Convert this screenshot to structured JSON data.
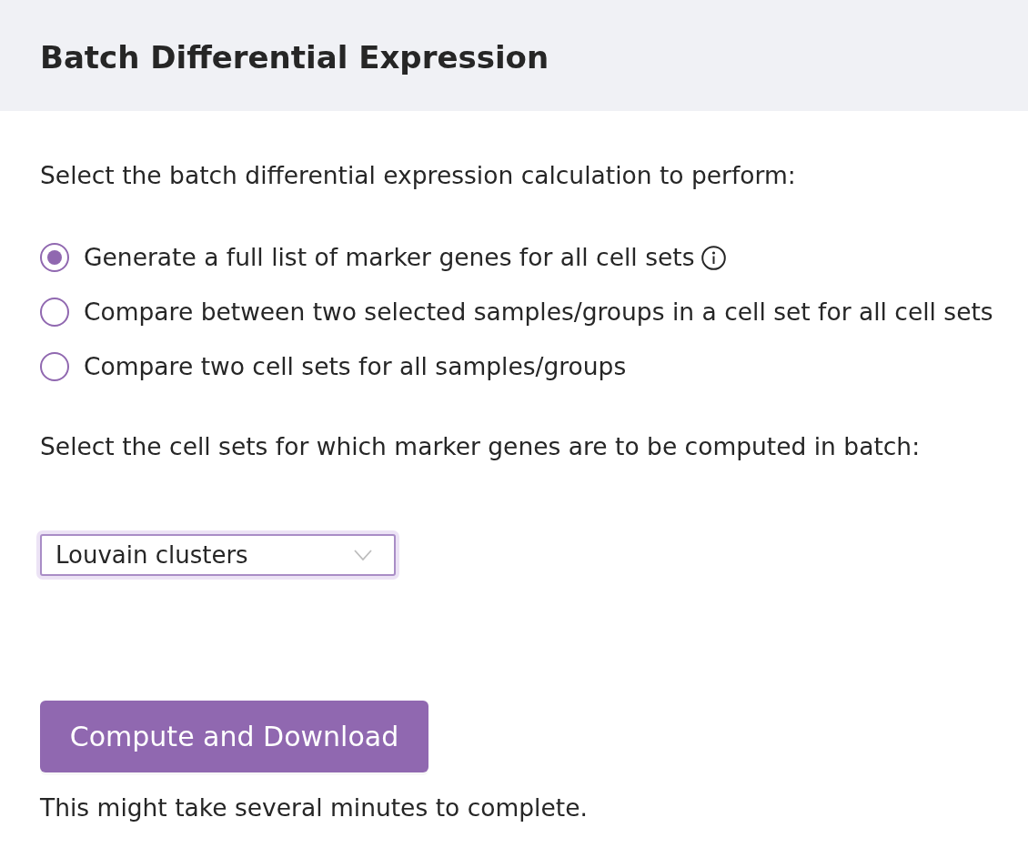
{
  "header": {
    "title": "Batch Differential Expression"
  },
  "calculation": {
    "prompt": "Select the batch differential expression calculation to perform:",
    "options": [
      {
        "label": "Generate a full list of marker genes for all cell sets",
        "selected": true,
        "info": true
      },
      {
        "label": "Compare between two selected samples/groups in a cell set for all cell sets",
        "selected": false,
        "info": false
      },
      {
        "label": "Compare two cell sets for all samples/groups",
        "selected": false,
        "info": false
      }
    ]
  },
  "cell_sets": {
    "prompt": "Select the cell sets for which marker genes are to be computed in batch:",
    "dropdown": {
      "value": "Louvain clusters",
      "focused": true
    }
  },
  "compute_button": {
    "label": "Compute and Download"
  },
  "note": "This might take several minutes to complete."
}
